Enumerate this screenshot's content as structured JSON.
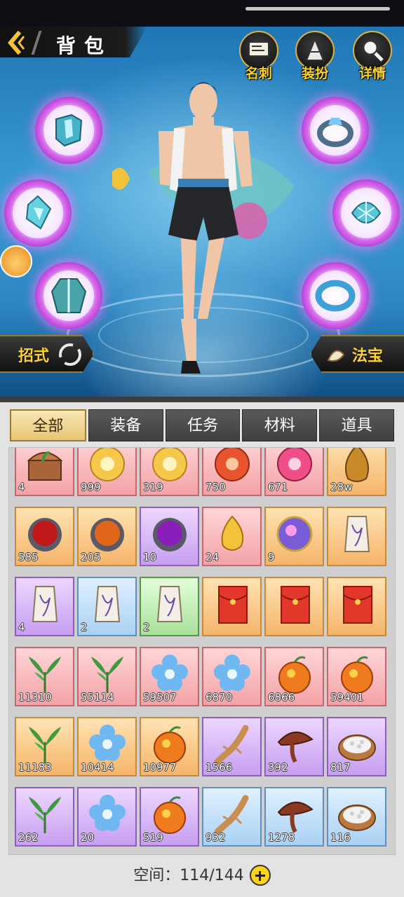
{
  "header": {
    "title": "背包",
    "buttons": [
      {
        "name": "card",
        "label": "名刺"
      },
      {
        "name": "outfit",
        "label": "装扮"
      },
      {
        "name": "details",
        "label": "详情"
      }
    ]
  },
  "character_panel": {
    "skill_button": "招式",
    "treasure_button": "法宝"
  },
  "tabs": [
    "全部",
    "装备",
    "任务",
    "材料",
    "道具"
  ],
  "active_tab": "全部",
  "inventory": {
    "rows": [
      [
        {
          "icon": "treasure-chest-icon",
          "qty": "4",
          "rarity": "pink"
        },
        {
          "icon": "golden-orb-icon",
          "qty": "999",
          "rarity": "pink"
        },
        {
          "icon": "golden-orb-icon",
          "qty": "319",
          "rarity": "pink"
        },
        {
          "icon": "red-orb-icon",
          "qty": "750",
          "rarity": "pink"
        },
        {
          "icon": "pink-orb-icon",
          "qty": "671",
          "rarity": "pink"
        },
        {
          "icon": "gold-ore-icon",
          "qty": "28w",
          "rarity": "orange"
        }
      ],
      [
        {
          "icon": "red-gem-icon",
          "qty": "585",
          "rarity": "orange"
        },
        {
          "icon": "orange-gem-icon",
          "qty": "205",
          "rarity": "orange"
        },
        {
          "icon": "purple-gem-icon",
          "qty": "10",
          "rarity": "purple"
        },
        {
          "icon": "gold-drop-icon",
          "qty": "24",
          "rarity": "pink"
        },
        {
          "icon": "galaxy-orb-icon",
          "qty": "9",
          "rarity": "orange"
        },
        {
          "icon": "talisman-icon",
          "qty": "",
          "rarity": "orange"
        }
      ],
      [
        {
          "icon": "talisman-icon",
          "qty": "4",
          "rarity": "purple"
        },
        {
          "icon": "talisman-icon",
          "qty": "2",
          "rarity": "blue"
        },
        {
          "icon": "talisman-icon",
          "qty": "2",
          "rarity": "green"
        },
        {
          "icon": "red-envelope-icon",
          "qty": "",
          "rarity": "orange"
        },
        {
          "icon": "red-envelope-icon",
          "qty": "",
          "rarity": "orange"
        },
        {
          "icon": "red-envelope-icon",
          "qty": "",
          "rarity": "orange"
        }
      ],
      [
        {
          "icon": "herb-sprout-icon",
          "qty": "11310",
          "rarity": "pink"
        },
        {
          "icon": "herb-sprout-icon",
          "qty": "55114",
          "rarity": "pink"
        },
        {
          "icon": "blue-flower-icon",
          "qty": "59507",
          "rarity": "pink"
        },
        {
          "icon": "blue-flower-icon",
          "qty": "6870",
          "rarity": "pink"
        },
        {
          "icon": "fire-fruit-icon",
          "qty": "6866",
          "rarity": "pink"
        },
        {
          "icon": "fire-fruit-icon",
          "qty": "59401",
          "rarity": "pink"
        }
      ],
      [
        {
          "icon": "herb-sprout-icon",
          "qty": "11183",
          "rarity": "orange"
        },
        {
          "icon": "blue-flower-icon",
          "qty": "10414",
          "rarity": "orange"
        },
        {
          "icon": "fire-fruit-icon",
          "qty": "10977",
          "rarity": "orange"
        },
        {
          "icon": "ginseng-icon",
          "qty": "1566",
          "rarity": "purple"
        },
        {
          "icon": "lingzhi-icon",
          "qty": "392",
          "rarity": "purple"
        },
        {
          "icon": "pearl-bowl-icon",
          "qty": "817",
          "rarity": "purple"
        }
      ],
      [
        {
          "icon": "herb-sprout-icon",
          "qty": "262",
          "rarity": "purple"
        },
        {
          "icon": "blue-flower-icon",
          "qty": "20",
          "rarity": "purple"
        },
        {
          "icon": "fire-fruit-icon",
          "qty": "519",
          "rarity": "purple"
        },
        {
          "icon": "ginseng-icon",
          "qty": "932",
          "rarity": "blue"
        },
        {
          "icon": "lingzhi-icon",
          "qty": "1278",
          "rarity": "blue"
        },
        {
          "icon": "pearl-bowl-icon",
          "qty": "116",
          "rarity": "blue"
        }
      ]
    ]
  },
  "capacity": {
    "label": "空间：",
    "value": "114/144"
  }
}
